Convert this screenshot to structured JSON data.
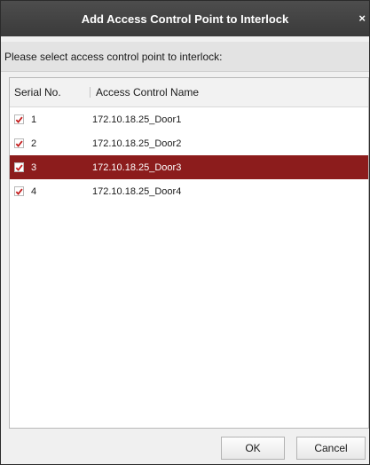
{
  "dialog": {
    "title": "Add Access Control Point to Interlock",
    "close_glyph": "×",
    "instruction": "Please select access control point to interlock:"
  },
  "table": {
    "columns": [
      "Serial No.",
      "Access Control Name"
    ],
    "rows": [
      {
        "serial": "1",
        "name": "172.10.18.25_Door1",
        "checked": true,
        "selected": false
      },
      {
        "serial": "2",
        "name": "172.10.18.25_Door2",
        "checked": true,
        "selected": false
      },
      {
        "serial": "3",
        "name": "172.10.18.25_Door3",
        "checked": true,
        "selected": true
      },
      {
        "serial": "4",
        "name": "172.10.18.25_Door4",
        "checked": true,
        "selected": false
      }
    ]
  },
  "buttons": {
    "ok": "OK",
    "cancel": "Cancel"
  },
  "colors": {
    "titlebar": "#3f3f3f",
    "selected_row": "#8c1c1c",
    "checkmark": "#c41e1e"
  }
}
